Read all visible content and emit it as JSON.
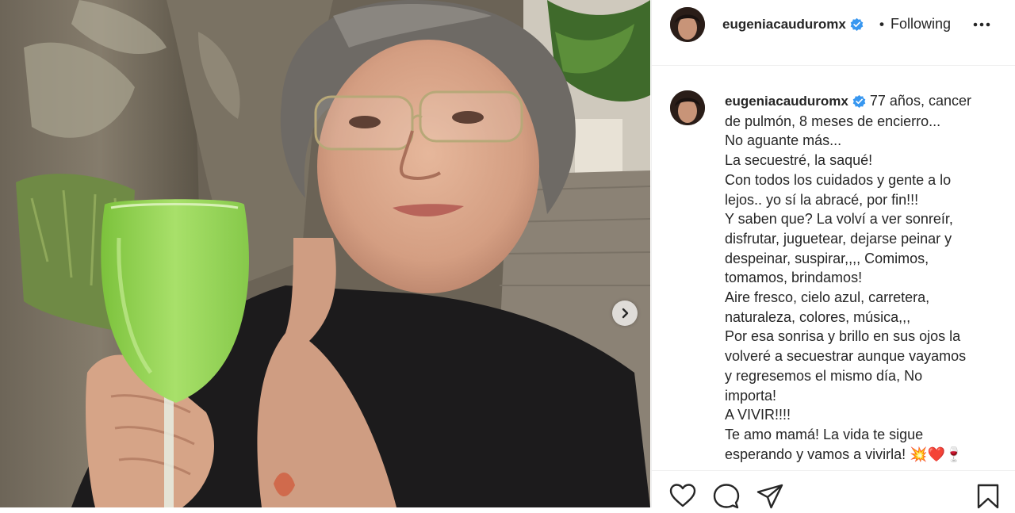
{
  "post": {
    "author": "eugeniacauduromx",
    "follow_separator": "•",
    "follow_status": "Following",
    "more_icon": "more-horizontal-icon",
    "caption_lines": [
      "77 años, cancer",
      "de pulmón, 8 meses de encierro...",
      "No aguante más...",
      "La secuestré, la saqué!",
      "Con todos los cuidados y gente a lo",
      "lejos.. yo sí la abracé, por fin!!!",
      "Y saben que? La volví a ver sonreír,",
      "disfrutar, juguetear, dejarse peinar y",
      "despeinar, suspirar,,,, Comimos,",
      "tomamos, brindamos!",
      "Aire fresco, cielo azul, carretera,",
      "naturaleza, colores, música,,,",
      "Por esa sonrisa y brillo en sus ojos la",
      "volveré a secuestrar aunque vayamos",
      "y regresemos el mismo día, No",
      "importa!",
      "A VIVIR!!!!",
      "Te amo mamá! La vida te sigue",
      "esperando y vamos a vivirla! 💥❤️🍷"
    ],
    "actions": [
      "heart-icon",
      "comment-icon",
      "share-icon",
      "bookmark-icon"
    ]
  },
  "colors": {
    "text": "#262626",
    "verified": "#3897f0",
    "divider": "#efefef",
    "drink": "#8dd14a"
  }
}
